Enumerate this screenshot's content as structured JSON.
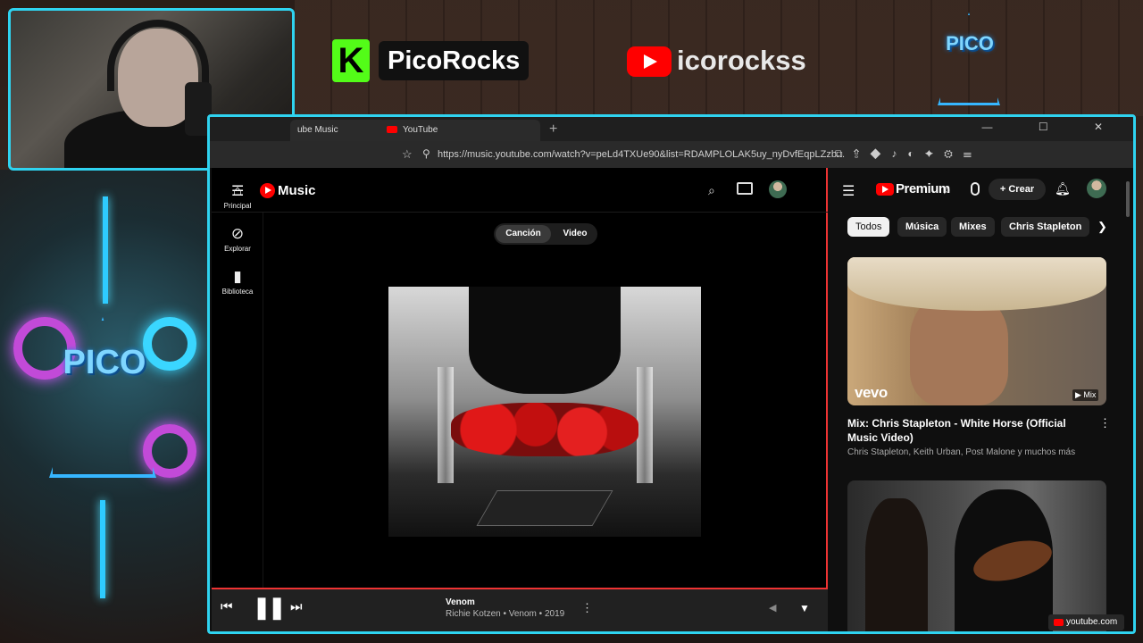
{
  "banner": {
    "kick_glyph": "K",
    "kick_channel": "PicoRocks",
    "youtube_channel": "icorockss",
    "logo_text": "PICO"
  },
  "browser": {
    "tabs": [
      {
        "label": "ube Music"
      },
      {
        "label": "YouTube"
      }
    ],
    "new_tab": "+",
    "window_controls": "— ☐ ✕",
    "url": "https://music.youtube.com/watch?v=peLd4TXUe90&list=RDAMPLOLAK5uy_nyDvfEqpLZzb..."
  },
  "ytmusic": {
    "app_name": "Music",
    "nav": [
      {
        "label": "Principal",
        "icon": "home-icon"
      },
      {
        "label": "Explorar",
        "icon": "compass-icon"
      },
      {
        "label": "Biblioteca",
        "icon": "library-icon"
      }
    ],
    "toggle": {
      "song": "Canción",
      "video": "Video"
    },
    "now_playing": {
      "title": "Venom",
      "subtitle": "Richie Kotzen • Venom • 2019"
    }
  },
  "youtube": {
    "brand": "Premium",
    "create_label": "Crear",
    "chips": [
      "Todos",
      "Música",
      "Mixes",
      "Chris Stapleton"
    ],
    "card1": {
      "logo": "vevo",
      "badge": "Mix",
      "title": "Mix: Chris Stapleton - White Horse (Official Music Video)",
      "subtitle": "Chris Stapleton, Keith Urban, Post Malone y muchos más"
    },
    "source_label": "youtube.com"
  },
  "colors": {
    "frame_accent": "#2fd3f0",
    "youtube_red": "#ff0000",
    "kick_green": "#53fc18",
    "ytm_progress": "#e33"
  }
}
